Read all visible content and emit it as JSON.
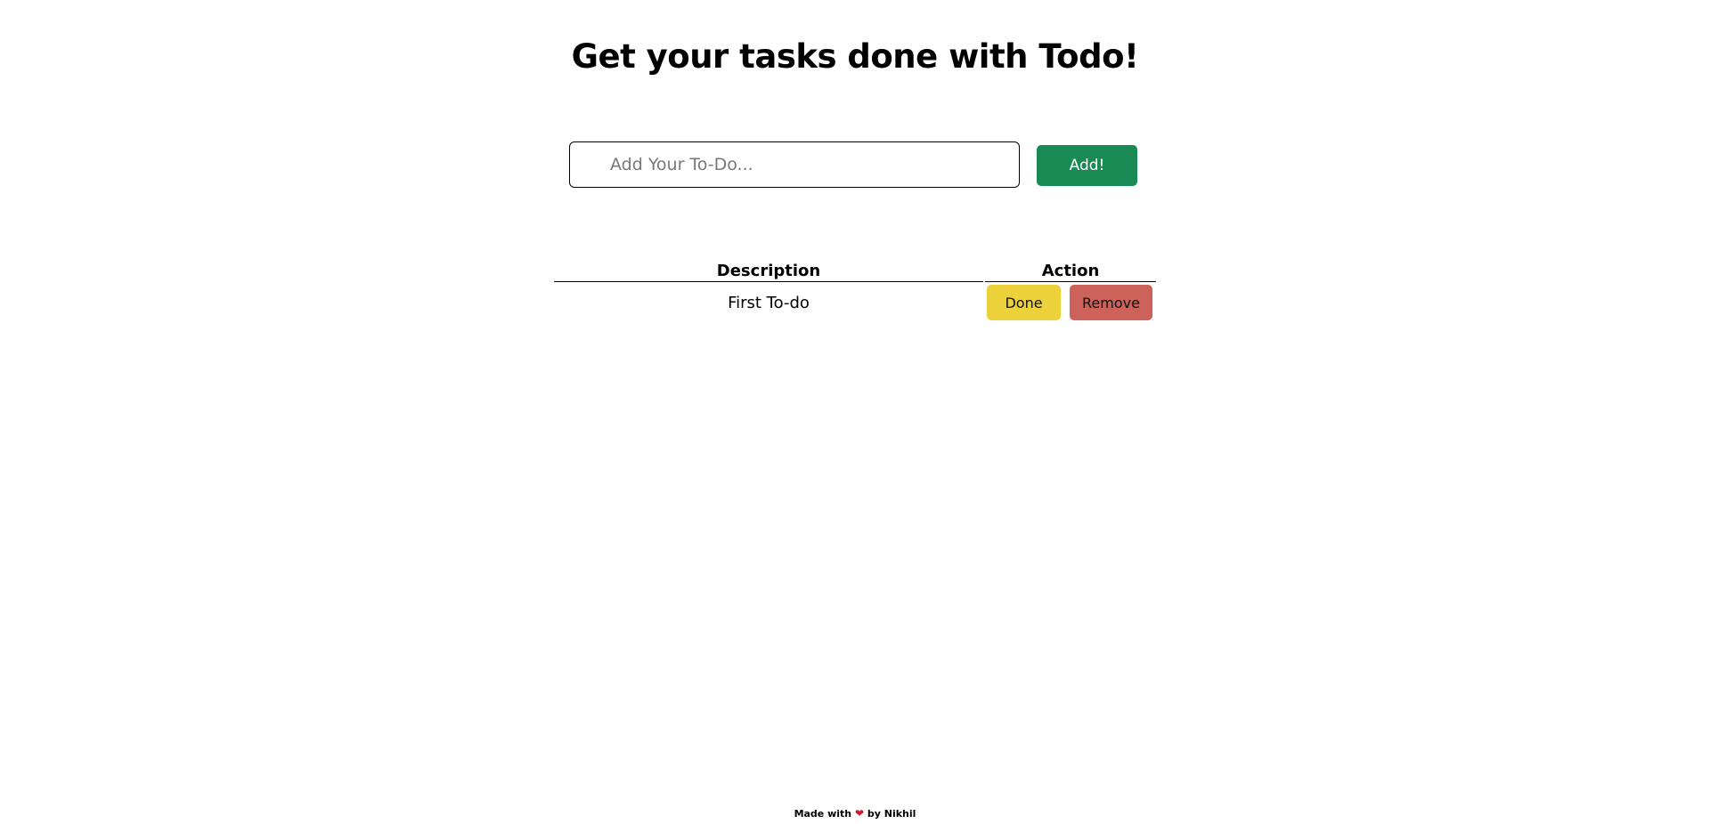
{
  "header": {
    "title": "Get your tasks done with Todo!"
  },
  "form": {
    "placeholder": "Add Your To-Do...",
    "value": "",
    "add_label": "Add!"
  },
  "table": {
    "headers": [
      "Description",
      "Action"
    ],
    "rows": [
      {
        "description": "First To-do",
        "done_label": "Done",
        "remove_label": "Remove"
      }
    ]
  },
  "footer": {
    "prefix": "Made with",
    "icon": "heart-icon",
    "suffix": "by Nikhil"
  },
  "colors": {
    "add": "#1a8a55",
    "done": "#ecd13a",
    "remove": "#cc6259",
    "heart": "#d01b2a"
  }
}
